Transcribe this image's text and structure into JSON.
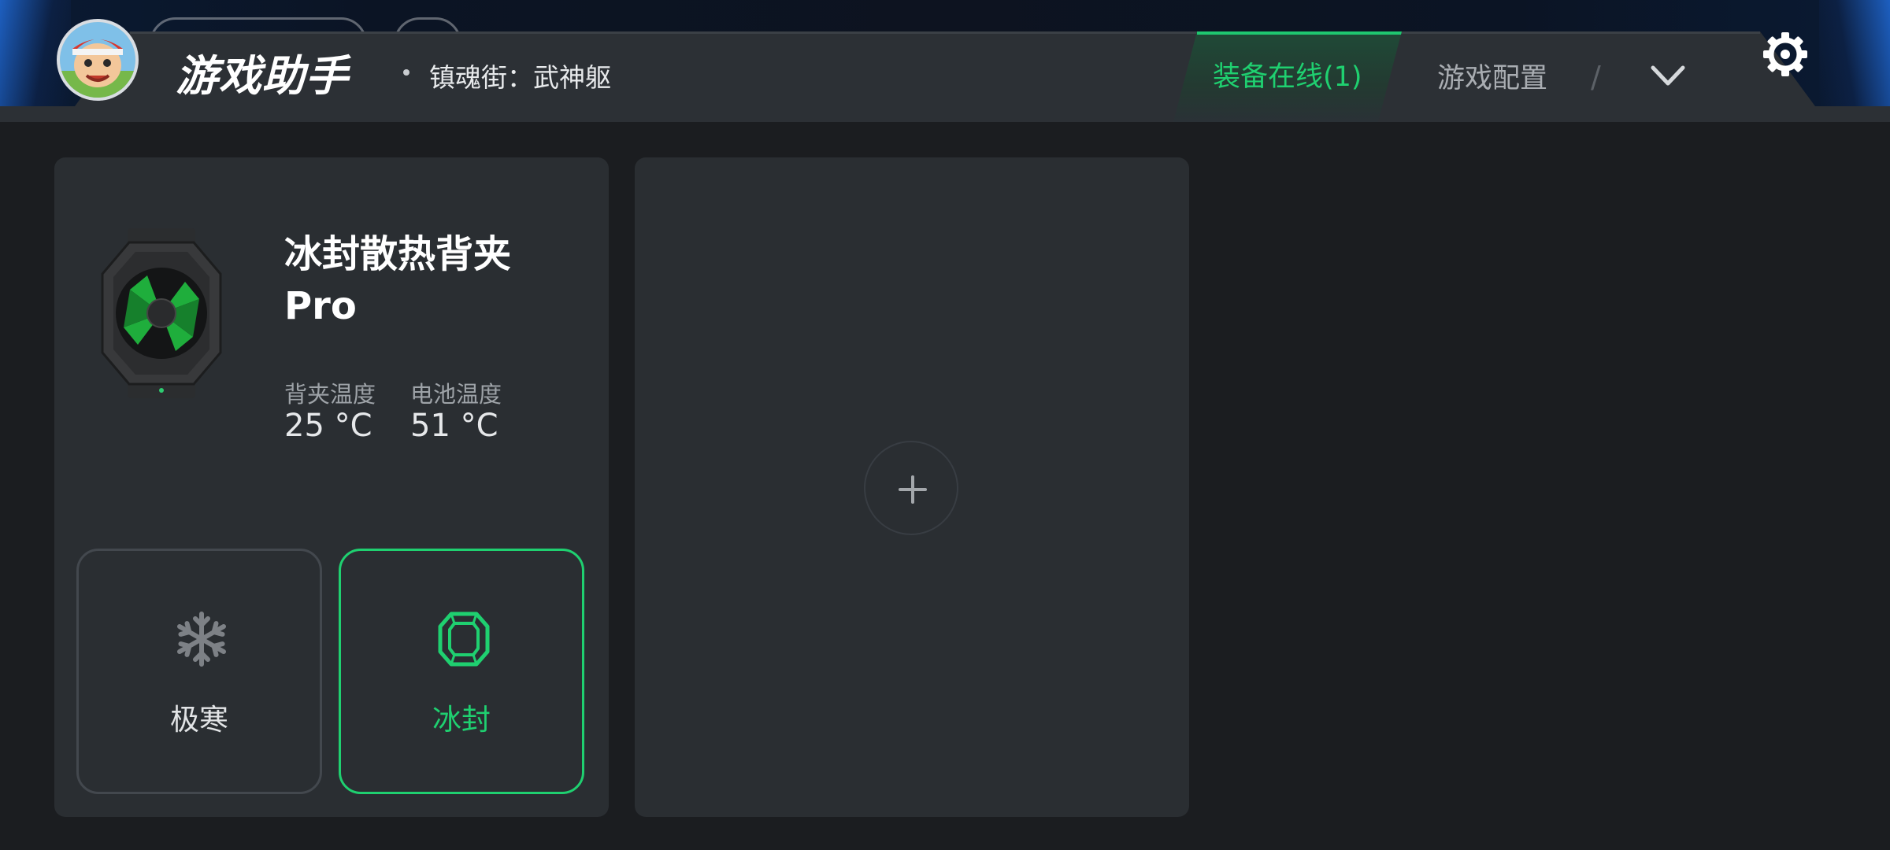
{
  "header": {
    "app_title": "游戏助手",
    "game_name": "镇魂街：武神躯",
    "tabs": [
      {
        "label": "装备在线(1)",
        "active": true
      },
      {
        "label": "游戏配置",
        "active": false
      }
    ],
    "tab_separator": "/",
    "icons": {
      "more": "chevron-down-icon",
      "settings": "gear-icon"
    }
  },
  "device": {
    "name": "冰封散热背夹Pro",
    "stats": [
      {
        "label": "背夹温度",
        "value": "25 °C"
      },
      {
        "label": "电池温度",
        "value": "51 °C"
      }
    ],
    "modes": [
      {
        "label": "极寒",
        "icon": "snowflake-icon",
        "selected": false
      },
      {
        "label": "冰封",
        "icon": "octagon-gem-icon",
        "selected": true
      }
    ]
  },
  "add_device": {
    "icon": "plus-icon"
  },
  "colors": {
    "accent": "#1fd070",
    "background": "#1b1d20",
    "card": "#2a2e32",
    "header": "#2c3035"
  }
}
